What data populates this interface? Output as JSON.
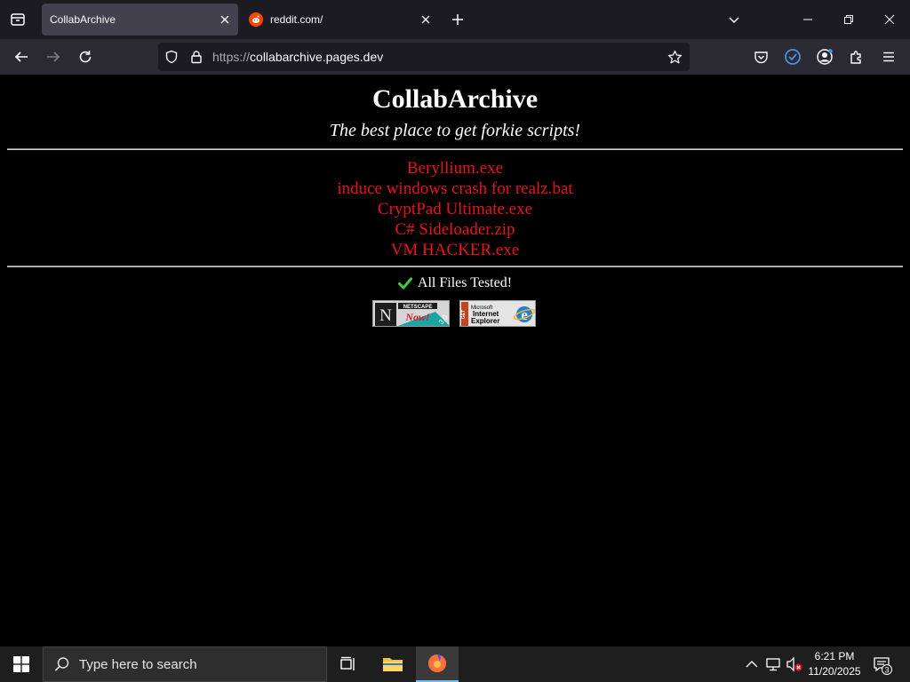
{
  "browser": {
    "tabs": [
      {
        "title": "CollabArchive",
        "active": true
      },
      {
        "title": "reddit.com/",
        "active": false,
        "favicon": "reddit-icon"
      }
    ],
    "url": {
      "scheme": "https://",
      "host": "collabarchive.pages.dev"
    },
    "colors": {
      "tabstrip": "#1c1b22",
      "toolbar": "#2b2a33",
      "active_tab": "#42414d"
    }
  },
  "page": {
    "title": "CollabArchive",
    "tagline": "The best place to get forkie scripts!",
    "files": [
      "Beryllium.exe",
      "induce windows crash for realz.bat",
      "CryptPad Ultimate.exe",
      "C# Sideloader.zip",
      "VM HACKER.exe"
    ],
    "tested": "All Files Tested!",
    "badges": {
      "netscape": {
        "top": "NETSCAPE",
        "now": "Now!",
        "version": "3.0",
        "letter": "N"
      },
      "ie": {
        "line1": "Microsoft",
        "line2": "Internet",
        "line3": "Explorer",
        "side": "GET"
      }
    },
    "colors": {
      "link": "#e8121c",
      "check": "#3ecf3e"
    }
  },
  "taskbar": {
    "search_placeholder": "Type here to search",
    "time": "6:21 PM",
    "date": "11/20/2025",
    "notification_count": "3"
  }
}
